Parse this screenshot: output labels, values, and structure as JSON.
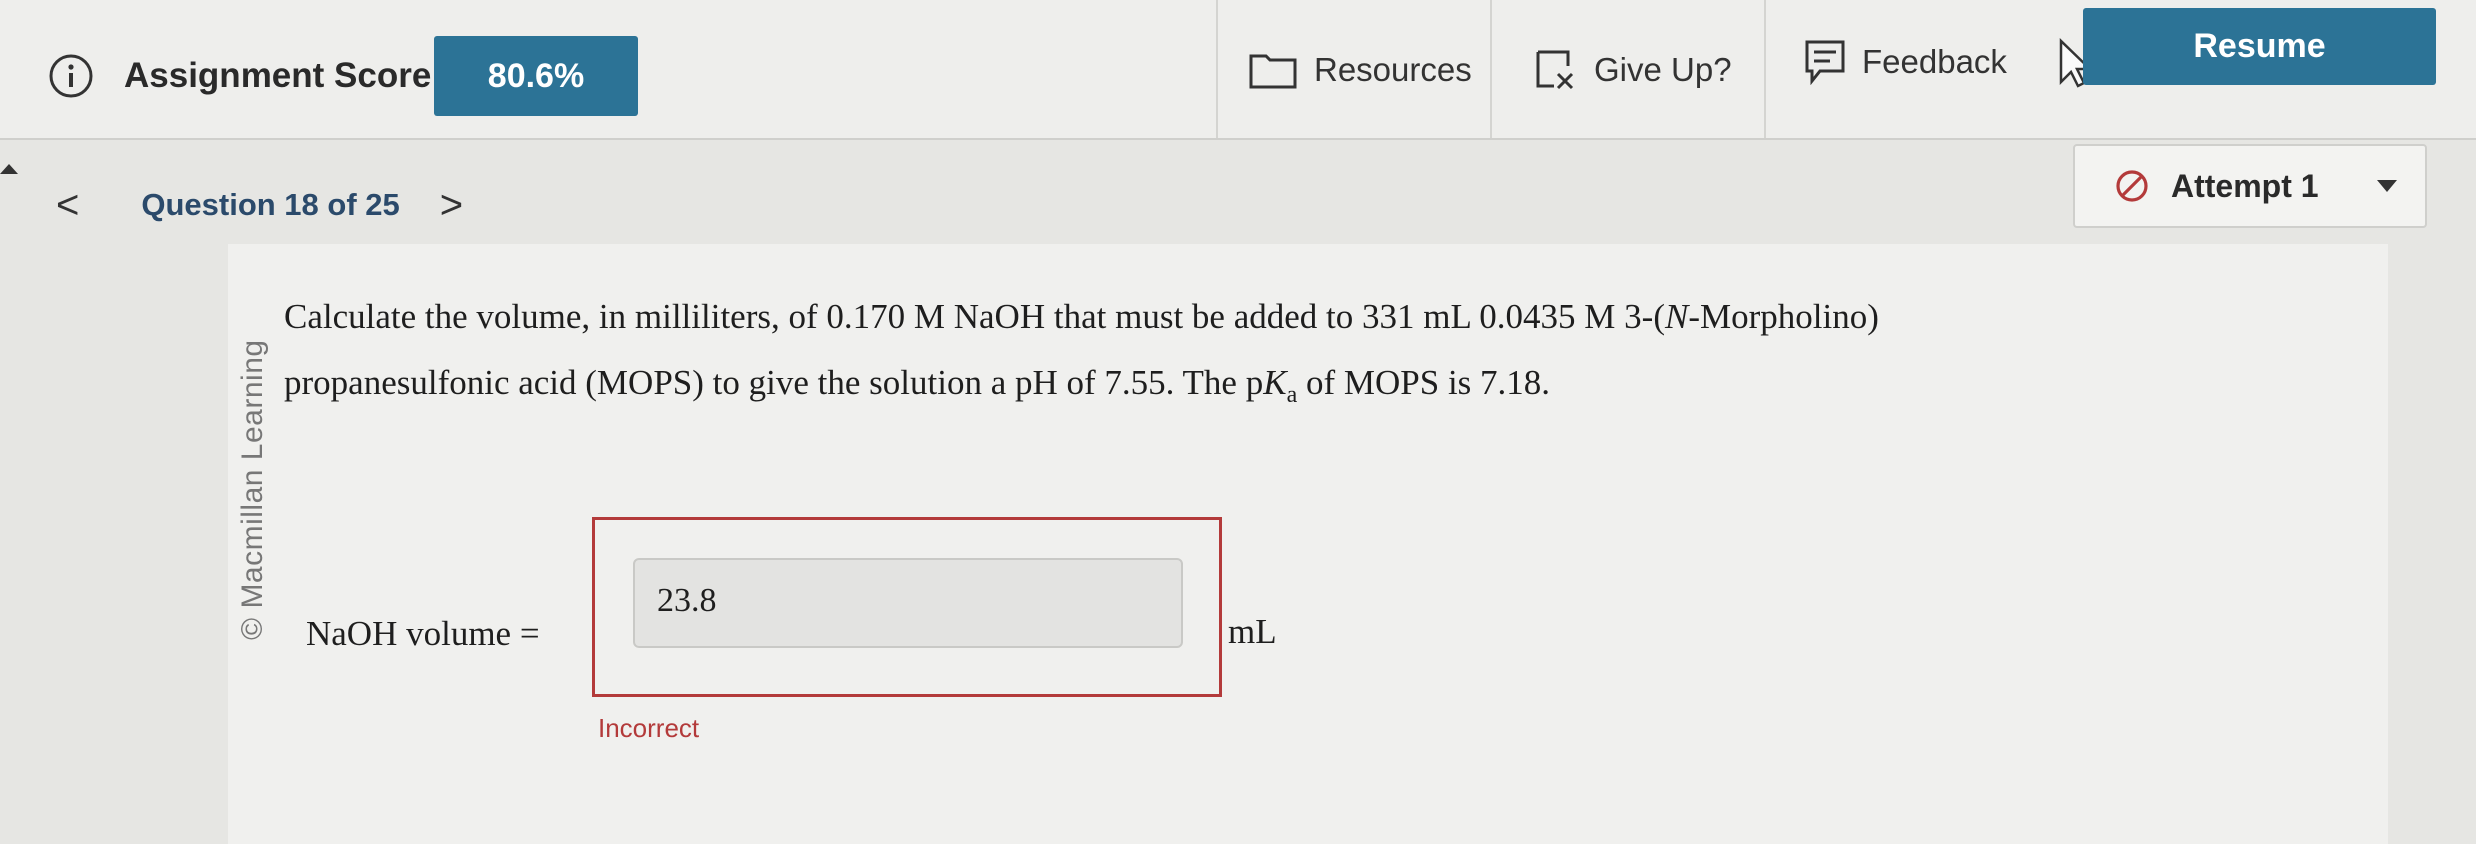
{
  "topbar": {
    "score_label": "Assignment Score:",
    "score_value": "80.6%",
    "resources_label": "Resources",
    "give_up_label": "Give Up?",
    "feedback_label": "Feedback",
    "resume_label": "Resume"
  },
  "nav": {
    "question_label": "Question 18 of 25",
    "prev": "<",
    "next": ">",
    "attempt_label": "Attempt 1"
  },
  "question": {
    "watermark": "© Macmillan Learning",
    "line1_a": "Calculate the volume, in milliliters, of 0.170 M NaOH that must be added to 331 mL 0.0435 M 3-(",
    "line1_italic": "N",
    "line1_b": "-Morpholino)",
    "line2_a": "propanesulfonic acid (MOPS) to give the solution a pH of 7.55. The p",
    "line2_k": "K",
    "line2_sub": "a",
    "line2_b": " of MOPS is 7.18."
  },
  "answer": {
    "label": "NaOH volume =",
    "value": "23.8",
    "unit": "mL",
    "status": "Incorrect"
  },
  "colors": {
    "accent": "#2c7396",
    "error": "#b33a3a"
  },
  "icons": [
    "info-icon",
    "folder-icon",
    "give-up-icon",
    "feedback-icon",
    "cursor-icon",
    "ban-icon",
    "dropdown-icon"
  ]
}
